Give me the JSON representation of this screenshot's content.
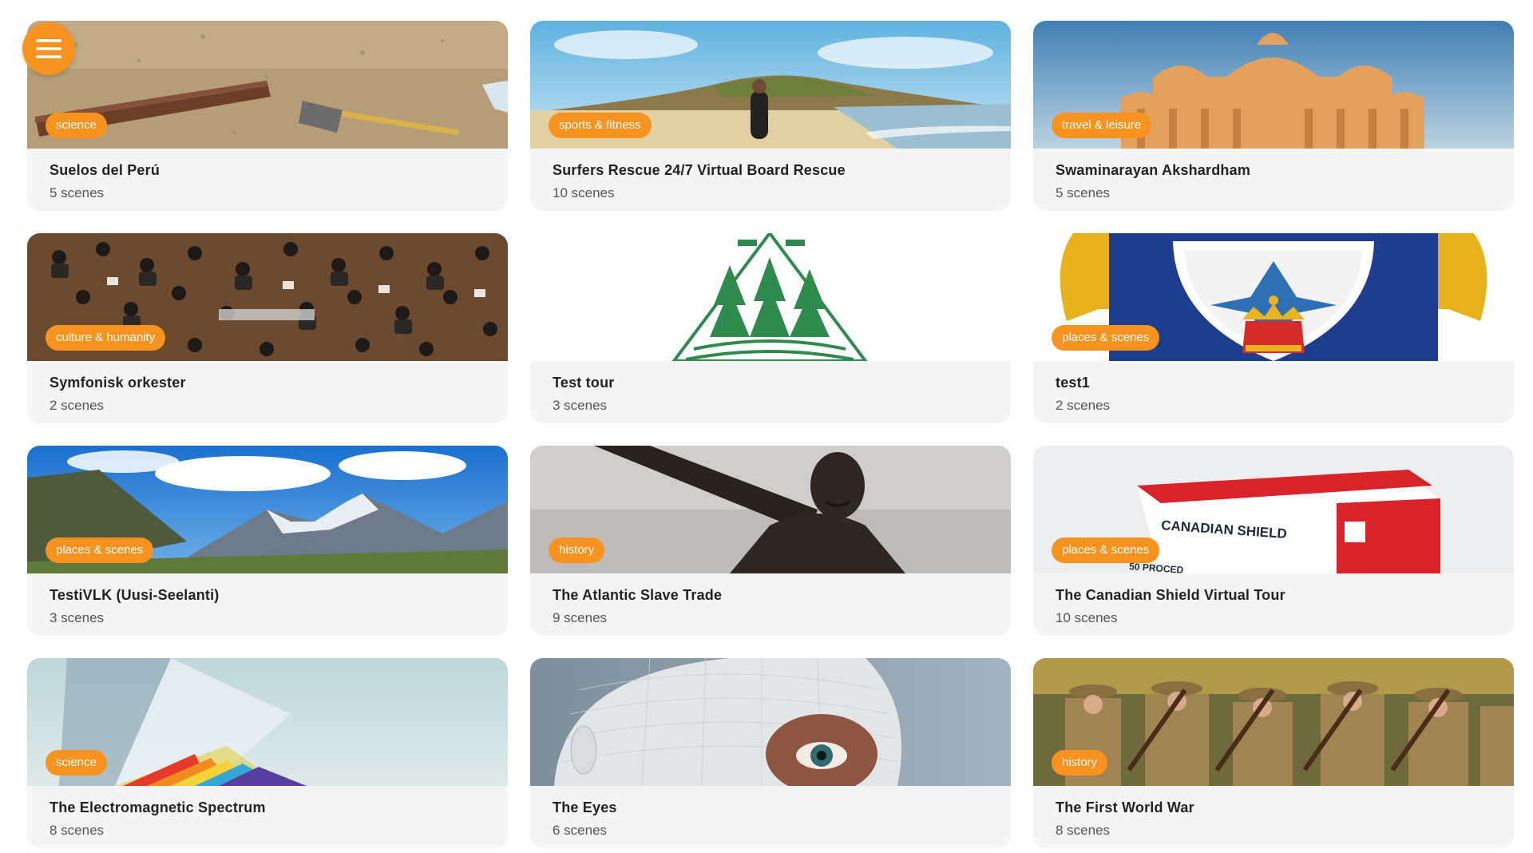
{
  "colors": {
    "accent": "#f7931e",
    "card_background": "#f5f5f5",
    "title_text": "#222222",
    "subtitle_text": "#555555"
  },
  "menu": {
    "icon": "hamburger-menu-icon"
  },
  "tours": [
    {
      "title": "Suelos del Perú",
      "scenes": "5 scenes",
      "category": "science"
    },
    {
      "title": "Surfers Rescue 24/7 Virtual Board Rescue",
      "scenes": "10 scenes",
      "category": "sports & fitness"
    },
    {
      "title": "Swaminarayan Akshardham",
      "scenes": "5 scenes",
      "category": "travel & leisure"
    },
    {
      "title": "Symfonisk orkester",
      "scenes": "2 scenes",
      "category": "culture & humanity"
    },
    {
      "title": "Test tour",
      "scenes": "3 scenes",
      "category": null
    },
    {
      "title": "test1",
      "scenes": "2 scenes",
      "category": "places & scenes"
    },
    {
      "title": "TestiVLK (Uusi-Seelanti)",
      "scenes": "3 scenes",
      "category": "places & scenes"
    },
    {
      "title": "The Atlantic Slave Trade",
      "scenes": "9 scenes",
      "category": "history"
    },
    {
      "title": "The Canadian Shield Virtual Tour",
      "scenes": "10 scenes",
      "category": "places & scenes"
    },
    {
      "title": "The Electromagnetic Spectrum",
      "scenes": "8 scenes",
      "category": "science"
    },
    {
      "title": "The Eyes",
      "scenes": "6 scenes",
      "category": null
    },
    {
      "title": "The First World War",
      "scenes": "8 scenes",
      "category": "history"
    }
  ],
  "thumbnail_text": {
    "canadian_shield_brand": "CANADIAN SHIELD",
    "canadian_shield_box_text": "50 PROCED"
  }
}
